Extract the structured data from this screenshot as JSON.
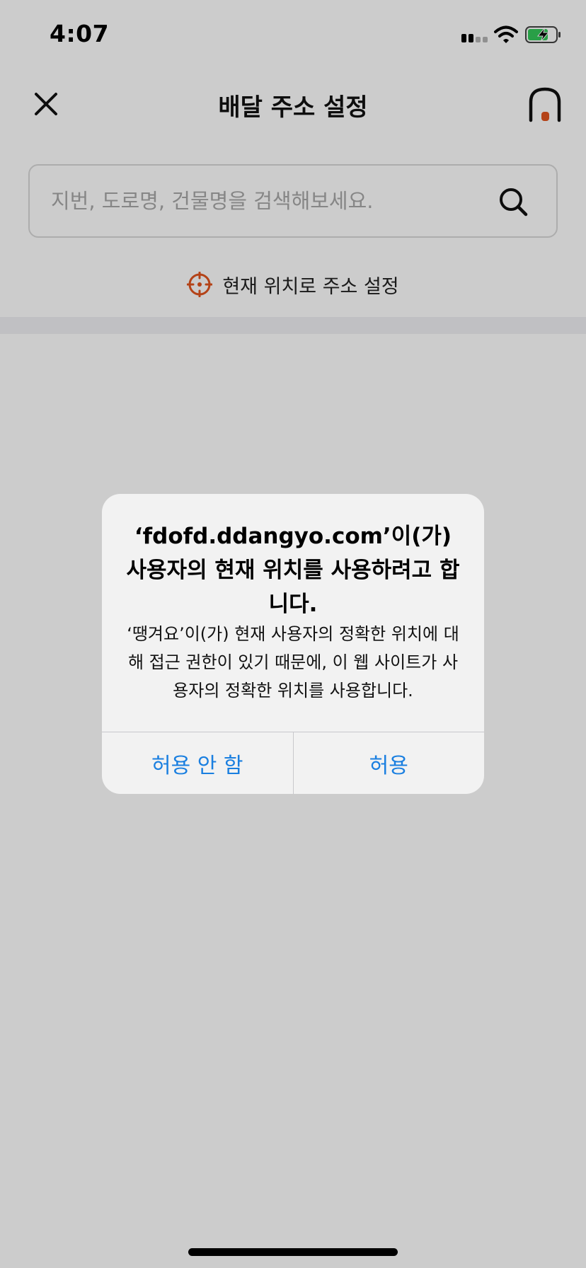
{
  "status_bar": {
    "time": "4:07"
  },
  "header": {
    "title": "배달 주소 설정"
  },
  "search": {
    "placeholder": "지번, 도로명, 건물명을 검색해보세요."
  },
  "current_location": {
    "label": "현재 위치로 주소 설정"
  },
  "alert": {
    "title": "‘fdofd.ddangyo.com’이(가) 사용자의 현재 위치를 사용하려고 합니다.",
    "message": "‘땡겨요’이(가) 현재 사용자의 정확한 위치에 대해 접근 권한이 있기 때문에, 이 웹 사이트가 사용자의 정확한 위치를 사용합니다.",
    "deny_label": "허용 안 함",
    "allow_label": "허용"
  },
  "icons": {
    "close": "close-icon",
    "home": "home-icon",
    "search": "search-icon",
    "target": "location-target-icon",
    "wifi": "wifi-icon",
    "battery": "battery-charging-icon",
    "signal": "cellular-signal-icon"
  },
  "colors": {
    "accent": "#e2541f",
    "link_blue": "#1a7fe0",
    "battery_green": "#34c759"
  }
}
